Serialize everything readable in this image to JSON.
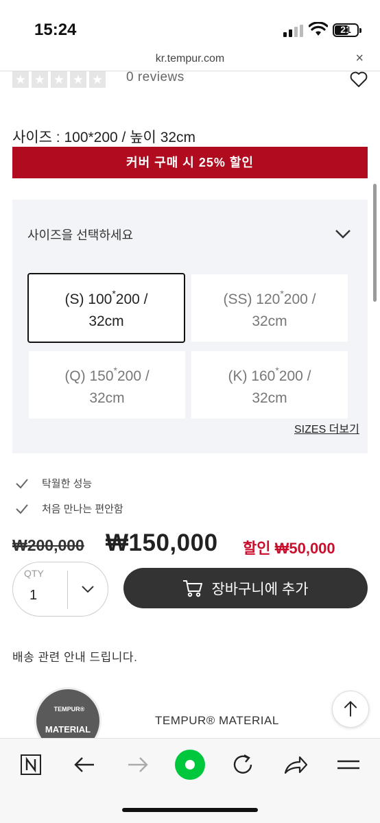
{
  "status": {
    "time": "15:24",
    "battery": "21"
  },
  "browser": {
    "url": "kr.tempur.com",
    "close": "×"
  },
  "product": {
    "reviews": "0 reviews",
    "size_line": "사이즈 : 100*200 / 높이 32cm",
    "promo": "커버 구매 시 25% 할인",
    "size_select_label": "사이즈을 선택하세요",
    "sizes_more": "SIZES 더보기",
    "options": [
      {
        "pre": "(S) 100",
        "post": "200 /",
        "line2": "32cm"
      },
      {
        "pre": "(SS) 120",
        "post": "200 /",
        "line2": "32cm"
      },
      {
        "pre": "(Q) 150",
        "post": "200 /",
        "line2": "32cm"
      },
      {
        "pre": "(K) 160",
        "post": "200 /",
        "line2": "32cm"
      }
    ],
    "asterisk": "*",
    "features": [
      "탁월한 성능",
      "처음 만나는 편안함"
    ],
    "original_price": "₩200,000",
    "price": "₩150,000",
    "discount": "할인 ₩50,000",
    "qty_label": "QTY",
    "qty_value": "1",
    "cart_button": "장바구니에 추가",
    "delivery": "배송 관련 안내 드립니다.",
    "badge_top": "TEMPUR®",
    "badge_bottom": "MATERIAL",
    "material_title": "TEMPUR® MATERIAL"
  },
  "colors": {
    "promo": "#b00b1e",
    "discount": "#c8102e",
    "cart": "#333333",
    "reload_dot": "#00c73c"
  },
  "toolbar": {
    "icons": [
      "naver-n-icon",
      "back-arrow-icon",
      "forward-arrow-icon",
      "home-dot-icon",
      "reload-icon",
      "share-icon",
      "menu-icon"
    ]
  }
}
